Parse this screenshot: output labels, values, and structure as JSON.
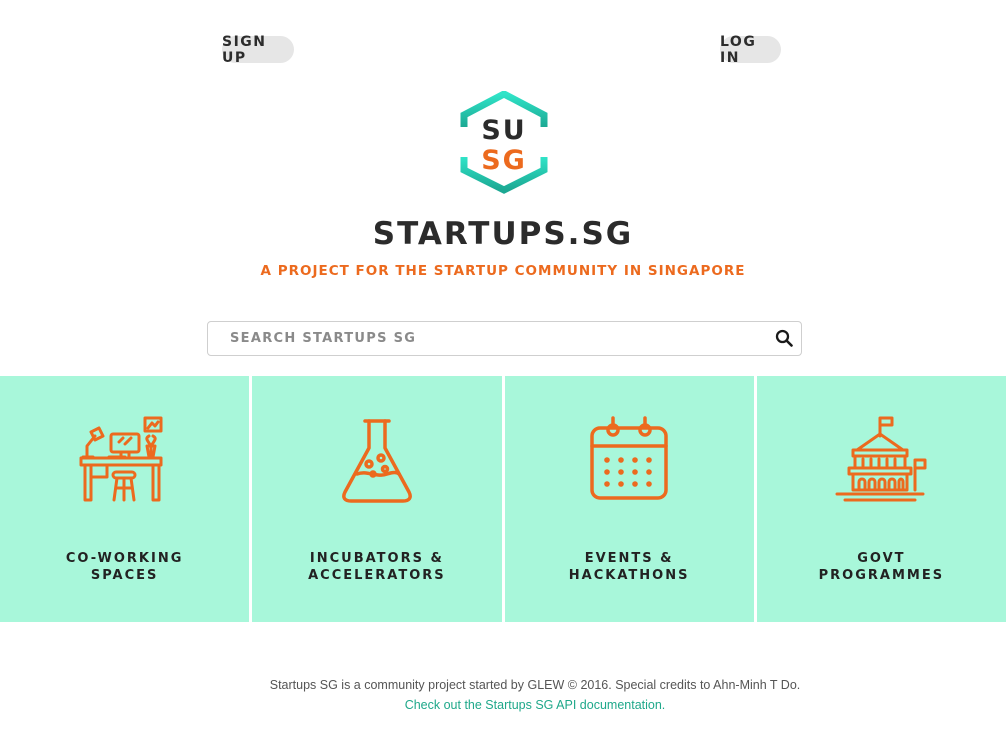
{
  "header": {
    "signup_label": "SIGN UP",
    "login_label": "LOG IN"
  },
  "logo": {
    "top_text": "SU",
    "bottom_text": "SG",
    "icon": "hexagon-logo-icon"
  },
  "site": {
    "title": "STARTUPS.SG",
    "tagline": "A PROJECT FOR THE STARTUP COMMUNITY IN SINGAPORE"
  },
  "search": {
    "placeholder": "SEARCH STARTUPS SG",
    "value": "",
    "icon": "search-icon"
  },
  "tiles": [
    {
      "line1": "CO-WORKING",
      "line2": "SPACES",
      "icon": "desk-workspace-icon"
    },
    {
      "line1": "INCUBATORS &",
      "line2": "ACCELERATORS",
      "icon": "flask-icon"
    },
    {
      "line1": "EVENTS &",
      "line2": "HACKATHONS",
      "icon": "calendar-icon"
    },
    {
      "line1": "GOVT",
      "line2": "PROGRAMMES",
      "icon": "government-building-icon"
    }
  ],
  "footer": {
    "text": "Startups SG is a community project started by GLEW © 2016. Special credits to Ahn-Minh T Do.",
    "link_text": "Check out the Startups SG API documentation."
  },
  "colors": {
    "accent_orange": "#ec6a1e",
    "tile_background": "#a8f7da",
    "logo_teal_top": "#2ee0c4",
    "logo_teal_bottom": "#1fae98",
    "link_green": "#1fa88a"
  }
}
